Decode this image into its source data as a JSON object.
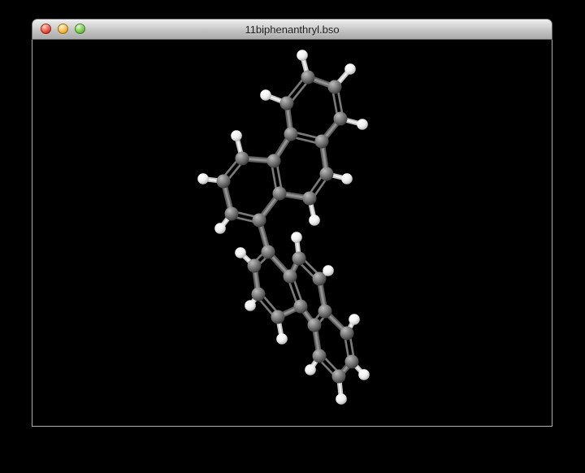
{
  "window": {
    "title": "11biphenanthryl.bso",
    "controls": [
      {
        "icon": "close-traffic-light-icon",
        "color": "#e0442f"
      },
      {
        "icon": "minimize-traffic-light-icon",
        "color": "#f0ad3a"
      },
      {
        "icon": "zoom-traffic-light-icon",
        "color": "#6ec243"
      }
    ]
  },
  "viewer": {
    "background": "#000000",
    "atom_colors": {
      "C": "#858585",
      "H": "#f4f4f4"
    },
    "atom_radius": {
      "C": 8.5,
      "H": 6.8
    },
    "bond_style": {
      "cc": "#5f5f5f",
      "cc_core": "#929292",
      "ch": "#c6c6c6",
      "ch_core": "#eeeeee",
      "double": "#7a7a7a",
      "cc_width": 7,
      "ch_width": 6,
      "double_width": 2.6,
      "double_offset": 3.2
    },
    "molecule": {
      "atoms": [
        [
          "uC4",
          "C",
          298,
          195
        ],
        [
          "uC3",
          "C",
          275,
          223
        ],
        [
          "uC2",
          "C",
          285,
          263
        ],
        [
          "uC4a",
          "C",
          337,
          198
        ],
        [
          "uC10a",
          "C",
          344,
          238
        ],
        [
          "uC5",
          "C",
          353,
          127
        ],
        [
          "uC6",
          "C",
          379,
          95
        ],
        [
          "uC7",
          "C",
          412,
          107
        ],
        [
          "uC4b",
          "C",
          358,
          165
        ],
        [
          "uC8a",
          "C",
          396,
          174
        ],
        [
          "uC8",
          "C",
          419,
          146
        ],
        [
          "uC9",
          "C",
          402,
          214
        ],
        [
          "uC10",
          "C",
          381,
          244
        ],
        [
          "uC1",
          "C",
          319,
          271
        ],
        [
          "uH2",
          "H",
          271,
          281
        ],
        [
          "uH3",
          "H",
          250,
          220
        ],
        [
          "uH4",
          "H",
          291,
          167
        ],
        [
          "uH5",
          "H",
          327,
          117
        ],
        [
          "uH6",
          "H",
          372,
          68
        ],
        [
          "uH7",
          "H",
          431,
          85
        ],
        [
          "uH8",
          "H",
          446,
          153
        ],
        [
          "uH9",
          "H",
          427,
          220
        ],
        [
          "uH10",
          "H",
          387,
          271
        ],
        [
          "lC10",
          "C",
          368,
          318
        ],
        [
          "lC9",
          "C",
          393,
          343
        ],
        [
          "lC10a",
          "C",
          357,
          340
        ],
        [
          "lC8a",
          "C",
          400,
          383
        ],
        [
          "lC4a",
          "C",
          370,
          377
        ],
        [
          "lC2",
          "C",
          313,
          327
        ],
        [
          "lC3",
          "C",
          318,
          362
        ],
        [
          "lC1",
          "C",
          330,
          310
        ],
        [
          "lC4",
          "C",
          342,
          390
        ],
        [
          "lC4b",
          "C",
          387,
          400
        ],
        [
          "lC8",
          "C",
          427,
          410
        ],
        [
          "lC5",
          "C",
          393,
          438
        ],
        [
          "lC7",
          "C",
          433,
          445
        ],
        [
          "lC6",
          "C",
          417,
          463
        ],
        [
          "lH2",
          "H",
          296,
          311
        ],
        [
          "lH3",
          "H",
          308,
          376
        ],
        [
          "lH4",
          "H",
          347,
          417
        ],
        [
          "lH5",
          "H",
          382,
          455
        ],
        [
          "lH6",
          "H",
          420,
          491
        ],
        [
          "lH7",
          "H",
          448,
          461
        ],
        [
          "lH8",
          "H",
          436,
          393
        ],
        [
          "lH9",
          "H",
          404,
          333
        ],
        [
          "lH10",
          "H",
          365,
          292
        ]
      ],
      "bonds": [
        [
          "uC1",
          "uC2",
          2
        ],
        [
          "uC2",
          "uC3",
          1
        ],
        [
          "uC3",
          "uC4",
          2
        ],
        [
          "uC4",
          "uC4a",
          1
        ],
        [
          "uC4a",
          "uC10a",
          2
        ],
        [
          "uC10a",
          "uC1",
          1
        ],
        [
          "uC4a",
          "uC4b",
          1
        ],
        [
          "uC4b",
          "uC5",
          1
        ],
        [
          "uC5",
          "uC6",
          2
        ],
        [
          "uC6",
          "uC7",
          1
        ],
        [
          "uC7",
          "uC8",
          2
        ],
        [
          "uC8",
          "uC8a",
          1
        ],
        [
          "uC8a",
          "uC4b",
          2
        ],
        [
          "uC8a",
          "uC9",
          1
        ],
        [
          "uC9",
          "uC10",
          2
        ],
        [
          "uC10",
          "uC10a",
          1
        ],
        [
          "uC2",
          "uH2",
          1
        ],
        [
          "uC3",
          "uH3",
          1
        ],
        [
          "uC4",
          "uH4",
          1
        ],
        [
          "uC5",
          "uH5",
          1
        ],
        [
          "uC6",
          "uH6",
          1
        ],
        [
          "uC7",
          "uH7",
          1
        ],
        [
          "uC8",
          "uH8",
          1
        ],
        [
          "uC9",
          "uH9",
          1
        ],
        [
          "uC10",
          "uH10",
          1
        ],
        [
          "uC1",
          "lC1",
          1
        ],
        [
          "lC1",
          "lC2",
          2
        ],
        [
          "lC2",
          "lC3",
          1
        ],
        [
          "lC3",
          "lC4",
          2
        ],
        [
          "lC4",
          "lC4a",
          1
        ],
        [
          "lC4a",
          "lC10a",
          2
        ],
        [
          "lC10a",
          "lC1",
          1
        ],
        [
          "lC4a",
          "lC4b",
          1
        ],
        [
          "lC4b",
          "lC5",
          1
        ],
        [
          "lC5",
          "lC6",
          2
        ],
        [
          "lC6",
          "lC7",
          1
        ],
        [
          "lC7",
          "lC8",
          2
        ],
        [
          "lC8",
          "lC8a",
          1
        ],
        [
          "lC8a",
          "lC4b",
          2
        ],
        [
          "lC8a",
          "lC9",
          1
        ],
        [
          "lC9",
          "lC10",
          2
        ],
        [
          "lC10",
          "lC10a",
          1
        ],
        [
          "lC2",
          "lH2",
          1
        ],
        [
          "lC3",
          "lH3",
          1
        ],
        [
          "lC4",
          "lH4",
          1
        ],
        [
          "lC5",
          "lH5",
          1
        ],
        [
          "lC6",
          "lH6",
          1
        ],
        [
          "lC7",
          "lH7",
          1
        ],
        [
          "lC8",
          "lH8",
          1
        ],
        [
          "lC9",
          "lH9",
          1
        ],
        [
          "lC10",
          "lH10",
          1
        ]
      ]
    }
  }
}
